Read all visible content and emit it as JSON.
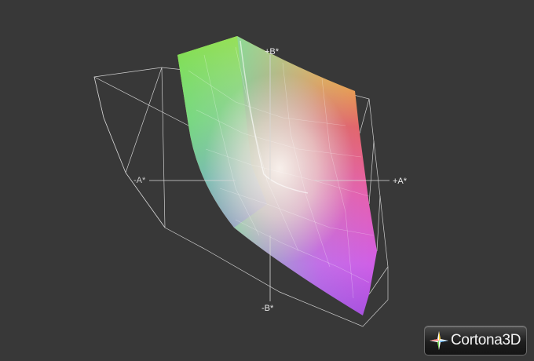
{
  "viewer": {
    "background_color": "#383838"
  },
  "axes": {
    "plus_b": "+B*",
    "minus_a": "-A*",
    "plus_a": "+A*",
    "minus_b": "-B*"
  },
  "logo": {
    "text": "Cortona3D"
  }
}
